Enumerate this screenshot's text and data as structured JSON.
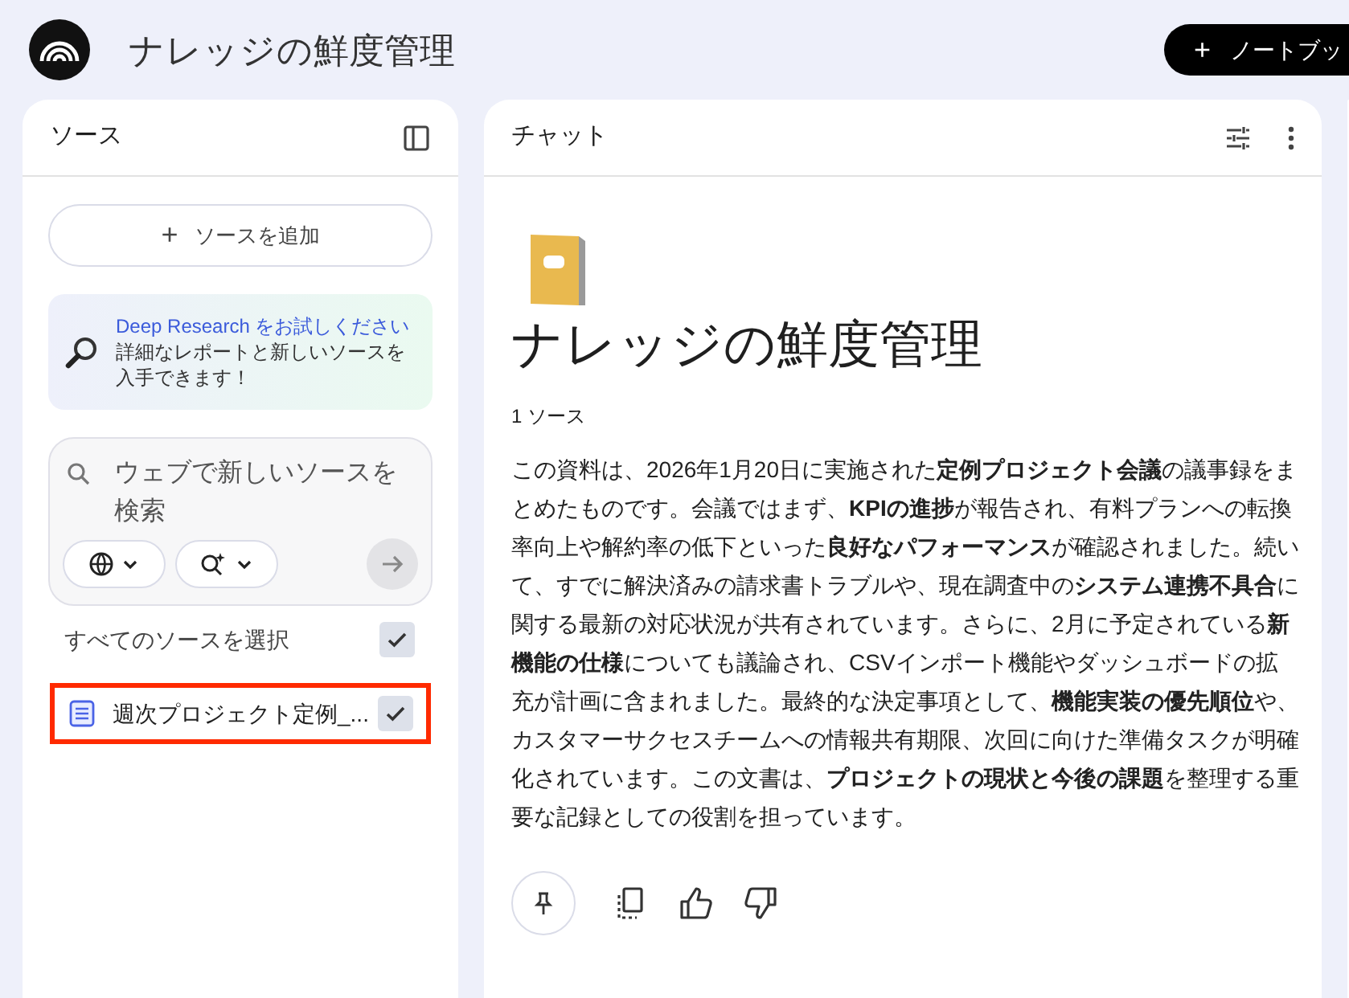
{
  "header": {
    "title": "ナレッジの鮮度管理",
    "new_button": {
      "icon": "+",
      "label": "ノートブッ"
    }
  },
  "sources_panel": {
    "title": "ソース",
    "add_button": {
      "icon": "+",
      "label": "ソースを追加"
    },
    "promo": {
      "link": "Deep Research をお試しください",
      "text": " 詳細なレポートと新しいソースを入手できます！"
    },
    "search": {
      "placeholder": "ウェブで新しいソースを検索"
    },
    "select_all": {
      "label": "すべてのソースを選択",
      "checked": true
    },
    "sources": [
      {
        "label": "週次プロジェクト定例_...",
        "checked": true,
        "highlighted": true
      }
    ]
  },
  "chat_panel": {
    "title": "チャット",
    "notebook_title": "ナレッジの鮮度管理",
    "source_count": "1 ソース",
    "summary": "この資料は、2026年1月20日に実施された**定例プロジェクト会議**の議事録をまとめたものです。会議ではまず、**KPIの進捗**が報告され、有料プランへの転換率向上や解約率の低下といった**良好なパフォーマンス**が確認されました。続いて、すでに解決済みの請求書トラブルや、現在調査中の**システム連携不具合**に関する最新の対応状況が共有されています。さらに、2月に予定されている**新機能の仕様**についても議論され、CSVインポート機能やダッシュボードの拡充が計画に含まれました。最終的な決定事項として、**機能実装の優先順位**や、カスタマーサクセスチームへの情報共有期限、次回に向けた準備タスクが明確化されています。この文書は、**プロジェクトの現状と今後の課題**を整理する重要な記録としての役割を担っています。"
  }
}
